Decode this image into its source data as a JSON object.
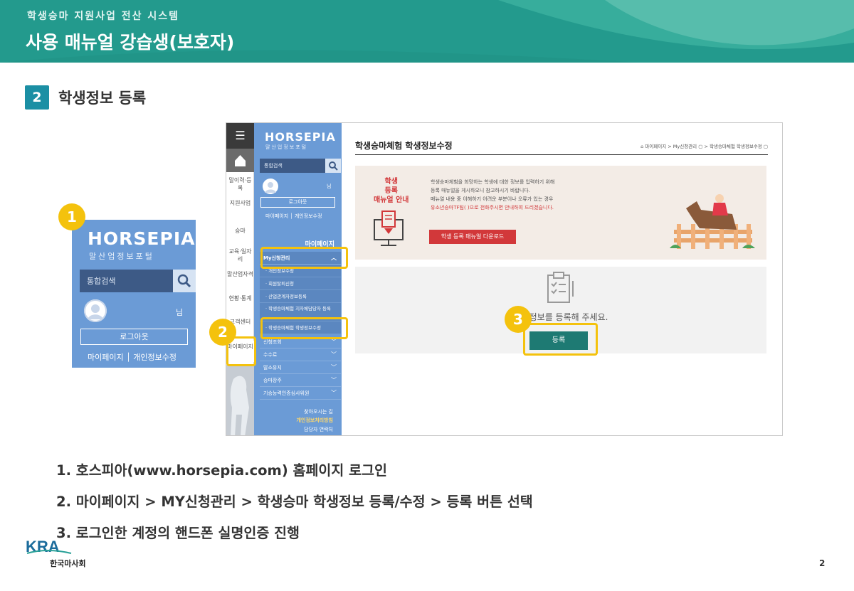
{
  "header": {
    "subtitle": "학생승마 지원사업 전산 시스템",
    "title": "사용 매뉴얼 강습생(보호자)"
  },
  "section": {
    "number": "2",
    "title": "학생정보 등록"
  },
  "markers": [
    "1",
    "2",
    "3"
  ],
  "zoom": {
    "logo": "HORSEPIA",
    "logo_sub": "말산업정보포털",
    "search_placeholder": "통합검색",
    "nim": "님",
    "logout": "로그아웃",
    "links": "마이페이지 │ 개인정보수정"
  },
  "site": {
    "iconbar": [
      "말이력·등록",
      "지원사업",
      "승마",
      "교육·일자리",
      "말산업자격",
      "현황·통계",
      "고객센터",
      "마이페이지"
    ],
    "nav": {
      "logo": "HORSEPIA",
      "logo_sub": "말산업정보포털",
      "search_placeholder": "통합검색",
      "nim": "님",
      "logout": "로그아웃",
      "links": "마이페이지 │ 개인정보수정",
      "heading": "마이페이지",
      "menu_open": "My신청관리",
      "sub_items": [
        "· 개인정보수정",
        "· 회원탈퇴신청",
        "· 산업관계자정보등록",
        "· 학생승마체험 지자체담당자 등록",
        "· 학생승마체험 학생정보수정"
      ],
      "menu_items": [
        "신청조회",
        "수수료",
        "말소유지",
        "승마장주",
        "기승능력인증심사위원"
      ],
      "footer": [
        "찾아오시는 길",
        "개인정보처리방침",
        "담당자 연락처"
      ]
    },
    "content": {
      "title": "학생승마체험 학생정보수정",
      "breadcrumb": "마이페이지 > My신청관리 ▢ > 학생승마체험 학생정보수정 ▢",
      "guide_label": [
        "학생",
        "등록",
        "매뉴얼 안내"
      ],
      "guide_desc": [
        "학생승마체험을 희망하는 학생에 대한 정보를 입력하기 위해",
        "등록 매뉴얼을 게시하오니 참고하시기 바랍니다.",
        "매뉴얼 내용 중 이해하기 어려운 부분이나 오류가 있는 경우",
        "유소년승마TF팀(                              )으로 전화주시면 안내하여 드리겠습니다."
      ],
      "download_button": "학생 등록 매뉴얼 다운로드",
      "empty_message": "학생정보를 등록해 주세요.",
      "register_button": "등록"
    }
  },
  "steps": [
    "1. 호스피아(www.horsepia.com) 홈페이지 로그인",
    "2. 마이페이지 > MY신청관리 > 학생승마 학생정보 등록/수정 > 등록 버튼 선택",
    "3. 로그인한 계정의 핸드폰 실명인증 진행"
  ],
  "footer": {
    "org_logo": "KRA",
    "org_name": "한국마사회",
    "page_number": "2"
  },
  "colors": {
    "header": "#239a8d",
    "nav": "#6b9bd6",
    "highlight": "#f4c20d",
    "accent_red": "#d2383a",
    "register": "#1e7a73"
  }
}
